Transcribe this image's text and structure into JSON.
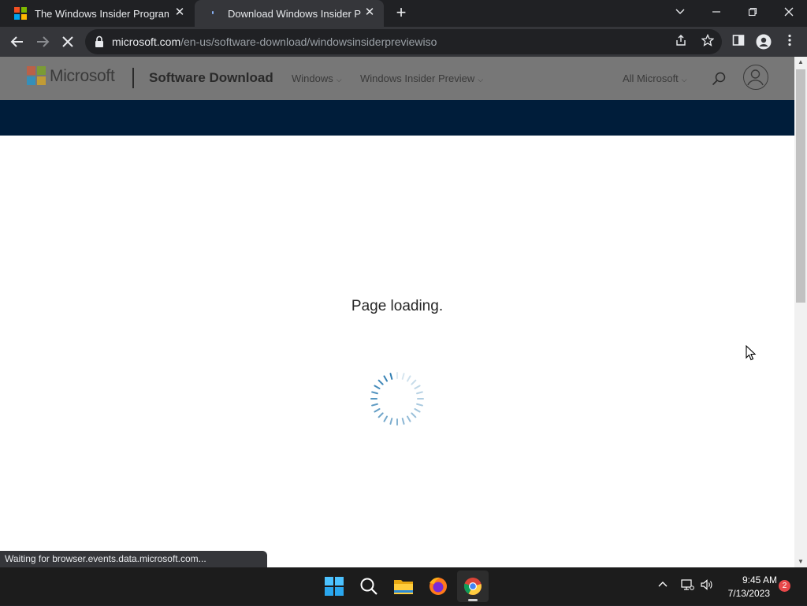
{
  "browser": {
    "tabs": [
      {
        "title": "The Windows Insider Program",
        "active": false
      },
      {
        "title": "Download Windows Insider Previ",
        "active": true
      }
    ],
    "new_tab_symbol": "+",
    "url_host": "microsoft.com",
    "url_path": "/en-us/software-download/windowsinsiderpreviewiso",
    "status_text": "Waiting for browser.events.data.microsoft.com..."
  },
  "site_header": {
    "brand": "Microsoft",
    "section_title": "Software Download",
    "nav": [
      {
        "label": "Windows"
      },
      {
        "label": "Windows Insider Preview"
      }
    ],
    "all_microsoft": "All Microsoft"
  },
  "page": {
    "loading_text": "Page loading."
  },
  "taskbar": {
    "time": "9:45 AM",
    "date": "7/13/2023",
    "notification_count": "2"
  },
  "colors": {
    "ms_red": "#f25022",
    "ms_green": "#7fba00",
    "ms_blue": "#00a4ef",
    "ms_yellow": "#ffb900",
    "hero_bar": "#001d3a",
    "spinner": "#2a7ab0"
  },
  "icons": [
    "windows-logo-icon",
    "close-icon",
    "plus-icon",
    "chevron-down-icon",
    "minimize-icon",
    "restore-icon",
    "back-icon",
    "forward-icon",
    "stop-icon",
    "lock-icon",
    "share-icon",
    "star-icon",
    "side-panel-icon",
    "profile-icon",
    "more-icon",
    "search-icon",
    "avatar-icon",
    "spinner-icon",
    "start-icon",
    "file-explorer-icon",
    "firefox-icon",
    "chrome-icon",
    "network-icon",
    "volume-icon"
  ]
}
